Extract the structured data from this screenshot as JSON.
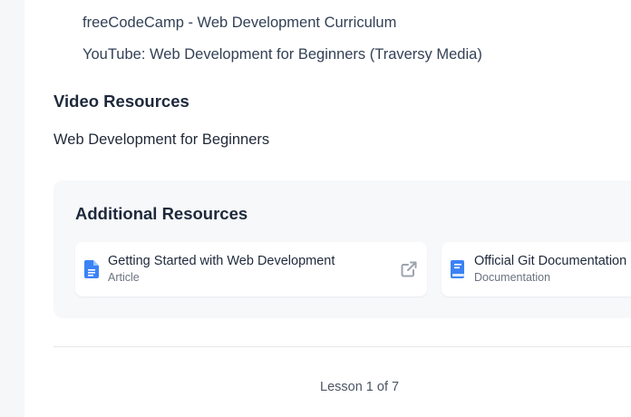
{
  "links": {
    "partial_item": "",
    "items": [
      "freeCodeCamp - Web Development Curriculum",
      "YouTube: Web Development for Beginners (Traversy Media)"
    ]
  },
  "video_section": {
    "heading": "Video Resources",
    "video_title": "Web Development for Beginners"
  },
  "additional_resources": {
    "heading": "Additional Resources",
    "cards": [
      {
        "title": "Getting Started with Web Development",
        "type": "Article",
        "icon": "document-icon"
      },
      {
        "title": "Official Git Documentation",
        "type": "Documentation",
        "icon": "book-icon"
      }
    ]
  },
  "footer": {
    "lesson_counter": "Lesson 1 of 7"
  },
  "colors": {
    "accent": "#3b82f6",
    "page_background": "#ffffff",
    "panel_background": "#f7f8fa"
  }
}
